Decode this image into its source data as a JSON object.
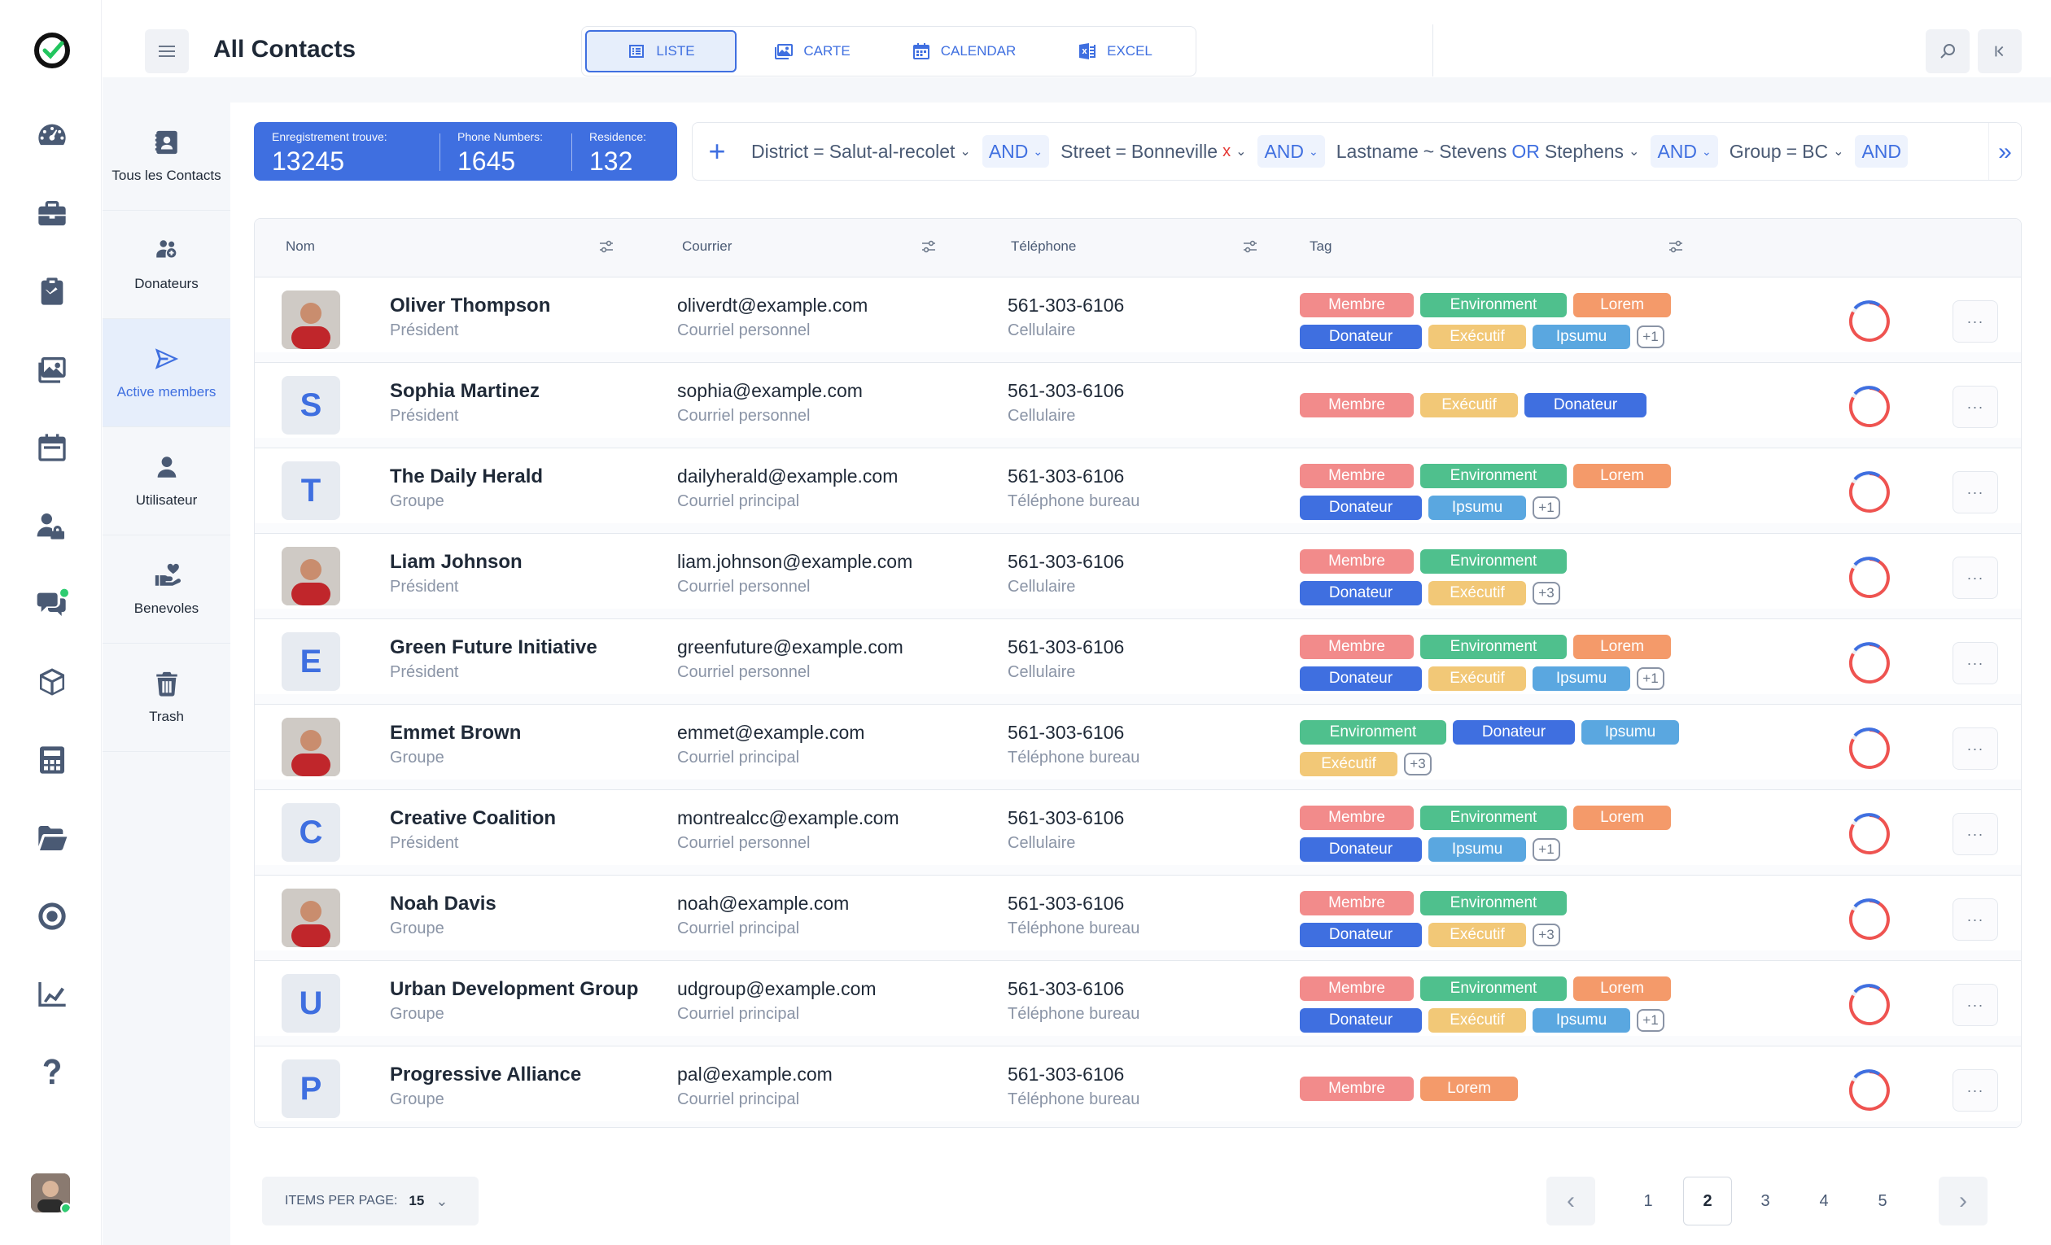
{
  "header": {
    "title": "All Contacts"
  },
  "view_tabs": [
    {
      "label": "LISTE",
      "icon": "list-icon",
      "active": true
    },
    {
      "label": "CARTE",
      "icon": "image-icon",
      "active": false
    },
    {
      "label": "CALENDAR",
      "icon": "calendar-icon",
      "active": false
    },
    {
      "label": "EXCEL",
      "icon": "excel-icon",
      "active": false
    }
  ],
  "subnav": [
    {
      "label": "Tous les Contacts",
      "icon": "contact-book-icon"
    },
    {
      "label": "Donateurs",
      "icon": "donors-icon"
    },
    {
      "label": "Active members",
      "icon": "send-icon",
      "active": true
    },
    {
      "label": "Utilisateur",
      "icon": "user-icon"
    },
    {
      "label": "Benevoles",
      "icon": "volunteer-hand-heart-icon"
    },
    {
      "label": "Trash",
      "icon": "trash-icon"
    }
  ],
  "rail_icons": [
    "logo-icon",
    "dashboard-icon",
    "briefcase-icon",
    "clipboard-check-icon",
    "images-icon",
    "calendar-icon",
    "users-lock-icon",
    "chat-icon",
    "box-icon",
    "calculator-icon",
    "folder-open-icon",
    "target-icon",
    "chart-icon",
    "help-icon"
  ],
  "stats": [
    {
      "label": "Enregistrement trouve:",
      "value": "13245"
    },
    {
      "label": "Phone Numbers:",
      "value": "1645"
    },
    {
      "label": "Residence:",
      "value": "132"
    }
  ],
  "filters": {
    "district_field": "District",
    "district_op": "=",
    "district_value": "Salut-al-recolet",
    "and": "AND",
    "street_field": "Street",
    "street_op": "=",
    "street_value": "Bonneville",
    "remove": "x",
    "lastname_field": "Lastname",
    "lastname_op": "~",
    "lastname_v1": "Stevens",
    "lastname_or": "OR",
    "lastname_v2": "Stephens",
    "group_field": "Group",
    "group_op": "=",
    "group_value": "BC"
  },
  "columns": {
    "name": "Nom",
    "email": "Courrier",
    "phone": "Téléphone",
    "tag": "Tag"
  },
  "tag_colors": {
    "Membre": "#f28b8b",
    "Environment": "#4fc08d",
    "Lorem": "#f49a6a",
    "Donateur": "#3f6fe0",
    "Exécutif": "#f2c877",
    "Ipsumu": "#5aa7e0"
  },
  "rows": [
    {
      "name": "Oliver Thompson",
      "role": "Président",
      "avatar": "photo",
      "email": "oliverdt@example.com",
      "email_type": "Courriel personnel",
      "phone": "561-303-6106",
      "phone_type": "Cellulaire",
      "tags": [
        [
          "Membre",
          "Environment",
          "Lorem"
        ],
        [
          "Donateur",
          "Exécutif",
          "Ipsumu"
        ]
      ],
      "more": "+1"
    },
    {
      "name": "Sophia Martinez",
      "role": "Président",
      "avatar": "S",
      "email": "sophia@example.com",
      "email_type": "Courriel personnel",
      "phone": "561-303-6106",
      "phone_type": "Cellulaire",
      "tags": [
        [
          "Membre",
          "Exécutif",
          "Donateur"
        ]
      ],
      "more": ""
    },
    {
      "name": "The Daily Herald",
      "role": "Groupe",
      "avatar": "T",
      "email": "dailyherald@example.com",
      "email_type": "Courriel principal",
      "phone": "561-303-6106",
      "phone_type": "Téléphone bureau",
      "tags": [
        [
          "Membre",
          "Environment",
          "Lorem"
        ],
        [
          "Donateur",
          "Ipsumu"
        ]
      ],
      "more": "+1"
    },
    {
      "name": "Liam Johnson",
      "role": "Président",
      "avatar": "photo",
      "email": "liam.johnson@example.com",
      "email_type": "Courriel personnel",
      "phone": "561-303-6106",
      "phone_type": "Cellulaire",
      "tags": [
        [
          "Membre",
          "Environment"
        ],
        [
          "Donateur",
          "Exécutif"
        ]
      ],
      "more": "+3"
    },
    {
      "name": "Green Future Initiative",
      "role": "Président",
      "avatar": "E",
      "email": "greenfuture@example.com",
      "email_type": "Courriel personnel",
      "phone": "561-303-6106",
      "phone_type": "Cellulaire",
      "tags": [
        [
          "Membre",
          "Environment",
          "Lorem"
        ],
        [
          "Donateur",
          "Exécutif",
          "Ipsumu"
        ]
      ],
      "more": "+1"
    },
    {
      "name": "Emmet Brown",
      "role": "Groupe",
      "avatar": "photo",
      "email": "emmet@example.com",
      "email_type": "Courriel principal",
      "phone": "561-303-6106",
      "phone_type": "Téléphone bureau",
      "tags": [
        [
          "Environment",
          "Donateur",
          "Ipsumu"
        ],
        [
          "Exécutif"
        ]
      ],
      "more": "+3"
    },
    {
      "name": "Creative Coalition",
      "role": "Président",
      "avatar": "C",
      "email": "montrealcc@example.com",
      "email_type": "Courriel personnel",
      "phone": "561-303-6106",
      "phone_type": "Cellulaire",
      "tags": [
        [
          "Membre",
          "Environment",
          "Lorem"
        ],
        [
          "Donateur",
          "Ipsumu"
        ]
      ],
      "more": "+1"
    },
    {
      "name": "Noah Davis",
      "role": "Groupe",
      "avatar": "photo",
      "email": "noah@example.com",
      "email_type": "Courriel principal",
      "phone": "561-303-6106",
      "phone_type": "Téléphone bureau",
      "tags": [
        [
          "Membre",
          "Environment"
        ],
        [
          "Donateur",
          "Exécutif"
        ]
      ],
      "more": "+3"
    },
    {
      "name": "Urban Development Group",
      "role": "Groupe",
      "avatar": "U",
      "email": "udgroup@example.com",
      "email_type": "Courriel principal",
      "phone": "561-303-6106",
      "phone_type": "Téléphone bureau",
      "tags": [
        [
          "Membre",
          "Environment",
          "Lorem"
        ],
        [
          "Donateur",
          "Exécutif",
          "Ipsumu"
        ]
      ],
      "more": "+1"
    },
    {
      "name": "Progressive Alliance",
      "role": "Groupe",
      "avatar": "P",
      "email": "pal@example.com",
      "email_type": "Courriel principal",
      "phone": "561-303-6106",
      "phone_type": "Téléphone bureau",
      "tags": [
        [
          "Membre",
          "Lorem"
        ]
      ],
      "more": ""
    }
  ],
  "row_menu": "···",
  "pagination": {
    "items_per_page_label": "ITEMS PER PAGE:",
    "items_per_page": "15",
    "pages": [
      "1",
      "2",
      "3",
      "4",
      "5"
    ],
    "current": "2",
    "prev": "‹",
    "next": "›"
  }
}
